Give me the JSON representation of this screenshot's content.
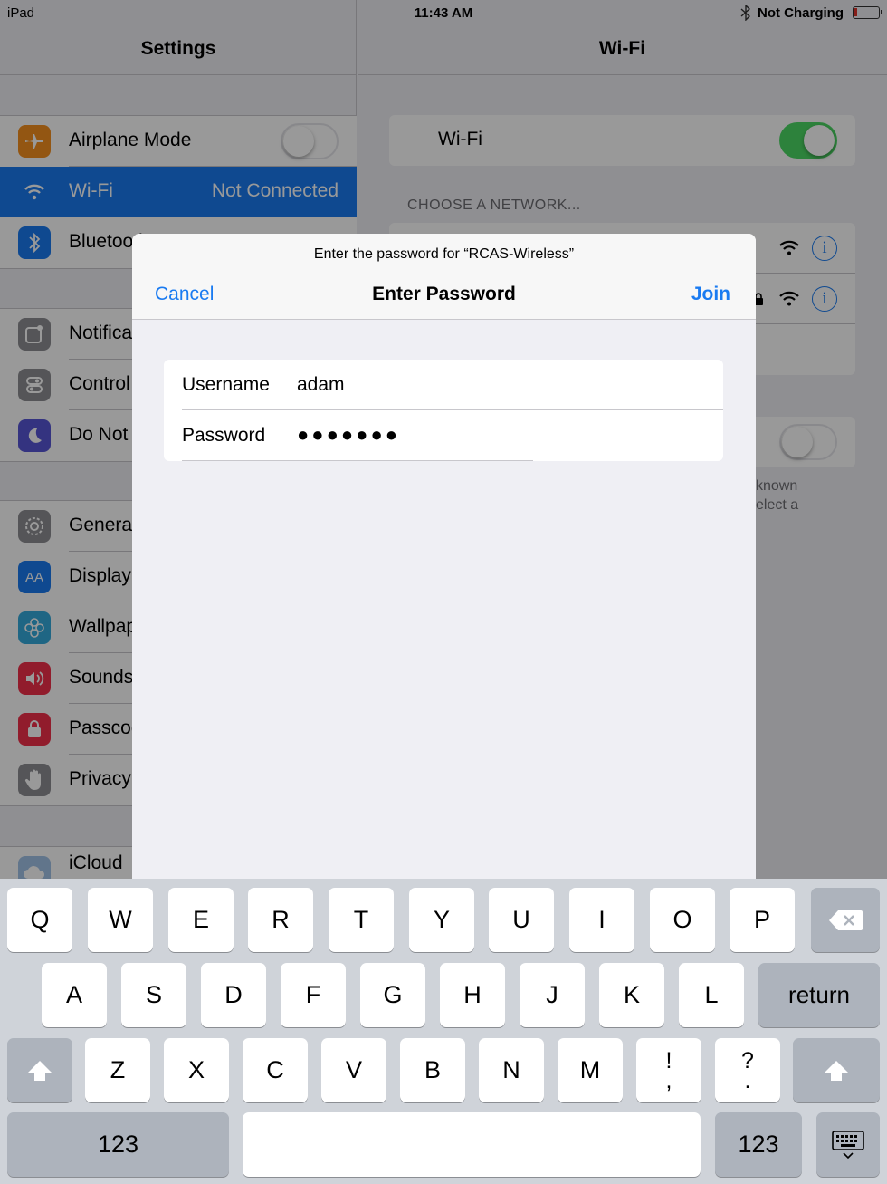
{
  "status": {
    "device": "iPad",
    "time": "11:43 AM",
    "charging": "Not Charging"
  },
  "settings": {
    "title": "Settings",
    "group1": [
      {
        "label": "Airplane Mode",
        "icon": "airplane-icon",
        "color": "#f6901e"
      },
      {
        "label": "Wi-Fi",
        "value": "Not Connected",
        "icon": "wifi-icon",
        "color": "#1a7bf1"
      },
      {
        "label": "Bluetooth",
        "icon": "bluetooth-icon",
        "color": "#1a7bf1"
      }
    ],
    "group2": [
      {
        "label": "Notification Center",
        "icon": "notification-icon",
        "color": "#8e8e93"
      },
      {
        "label": "Control Center",
        "icon": "control-center-icon",
        "color": "#8e8e93"
      },
      {
        "label": "Do Not Disturb",
        "icon": "moon-icon",
        "color": "#5856d6"
      }
    ],
    "group3": [
      {
        "label": "General",
        "icon": "gear-icon",
        "color": "#8e8e93"
      },
      {
        "label": "Display & Brightness",
        "icon": "display-icon",
        "color": "#1a7bf1"
      },
      {
        "label": "Wallpaper",
        "icon": "wallpaper-icon",
        "color": "#35aadc"
      },
      {
        "label": "Sounds",
        "icon": "sound-icon",
        "color": "#f2304a"
      },
      {
        "label": "Passcode",
        "icon": "lock-icon",
        "color": "#f2304a"
      },
      {
        "label": "Privacy",
        "icon": "hand-icon",
        "color": "#8e8e93"
      }
    ],
    "group4": [
      {
        "label": "iCloud",
        "icon": "cloud-icon",
        "color": "#a2c4e8"
      }
    ]
  },
  "wifi": {
    "title": "Wi-Fi",
    "toggle_label": "Wi-Fi",
    "choose_header": "CHOOSE A NETWORK...",
    "ask_text_1": "known",
    "ask_text_2": "elect a"
  },
  "modal": {
    "prompt": "Enter the password for “RCAS-Wireless”",
    "title": "Enter Password",
    "cancel": "Cancel",
    "join": "Join",
    "username_label": "Username",
    "username_value": "adam",
    "password_label": "Password",
    "password_value": "●●●●●●●"
  },
  "keyboard": {
    "row1": [
      "Q",
      "W",
      "E",
      "R",
      "T",
      "Y",
      "U",
      "I",
      "O",
      "P"
    ],
    "row2": [
      "A",
      "S",
      "D",
      "F",
      "G",
      "H",
      "J",
      "K",
      "L"
    ],
    "row3": [
      "Z",
      "X",
      "C",
      "V",
      "B",
      "N",
      "M"
    ],
    "return": "return",
    "numbers": "123",
    "punct1_top": "!",
    "punct1_bottom": ",",
    "punct2_top": "?",
    "punct2_bottom": "."
  }
}
